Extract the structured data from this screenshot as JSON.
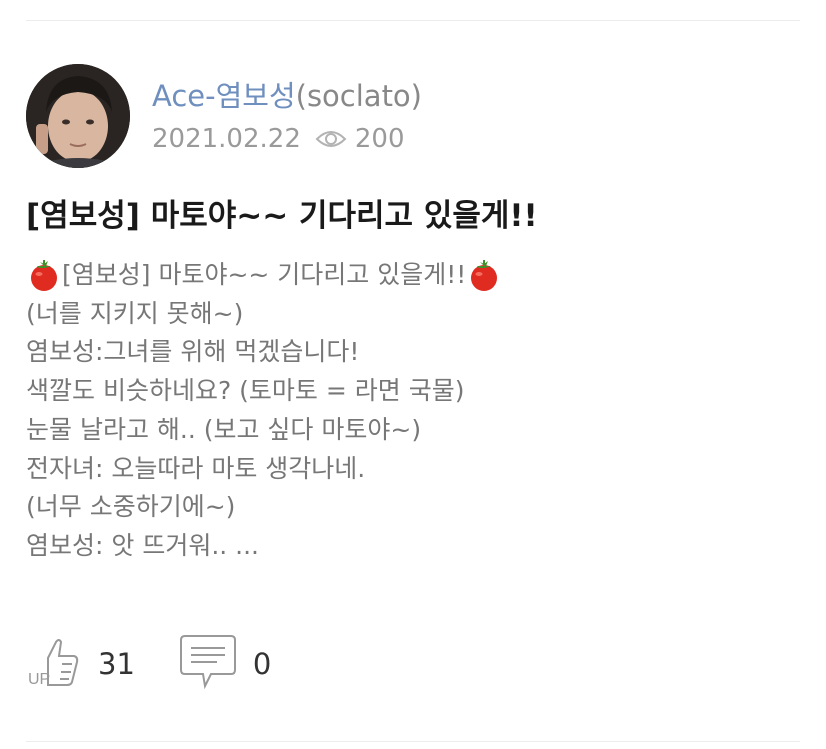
{
  "post": {
    "author_name": "Ace-염보성",
    "author_id": "(soclato)",
    "date": "2021.02.22",
    "views": "200",
    "title": "[염보성] 마토야~~ 기다리고 있을게!!",
    "body_lines": [
      "[염보성] 마토야~~ 기다리고 있을게!!",
      "(너를 지키지 못해~)",
      "염보성:그녀를 위해 먹겠습니다!",
      "색깔도 비슷하네요? (토마토 = 라면 국물)",
      "눈물 날라고 해.. (보고 싶다 마토야~)",
      "전자녀: 오늘따라 마토 생각나네.",
      "(너무 소중하기에~)",
      "염보성: 앗 뜨거워.. ..."
    ]
  },
  "actions": {
    "like_icon_label": "UP",
    "like_count": "31",
    "comment_count": "0"
  },
  "icons": {
    "views": "eye-icon",
    "like": "thumbs-up-icon",
    "comment": "comment-bubble-icon",
    "emoji": "tomato-icon"
  },
  "colors": {
    "author_name": "#6f8fbf",
    "meta_text": "#9a9a9a",
    "body_text": "#777777",
    "title_text": "#1a1a1a"
  }
}
